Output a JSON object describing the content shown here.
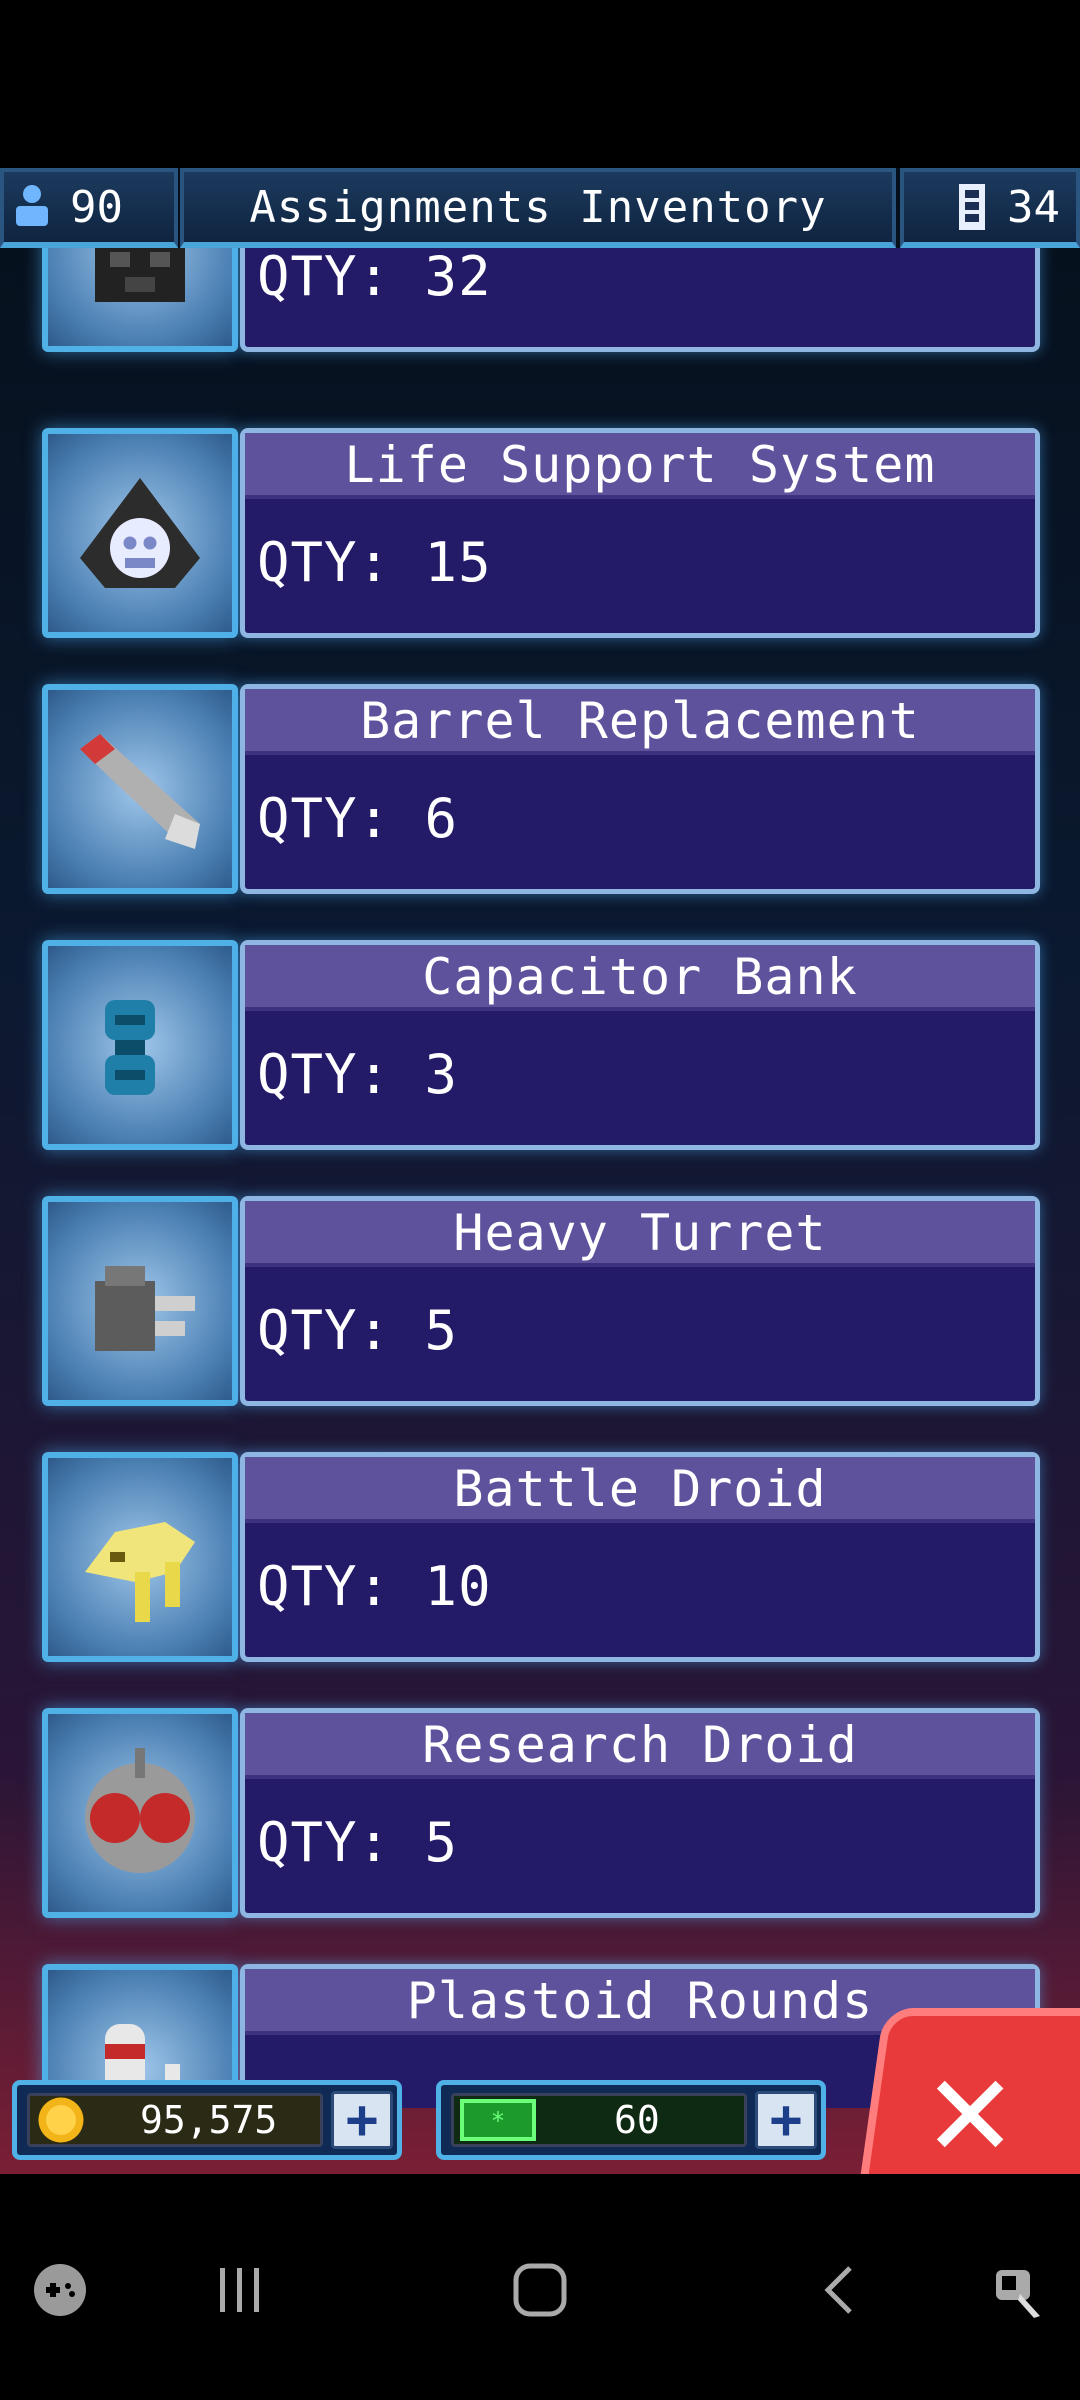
{
  "header": {
    "crew_count": "90",
    "title": "Assignments Inventory",
    "storage_count": "34"
  },
  "items": [
    {
      "name": "",
      "qty": "QTY: 32",
      "icon": "armor-helmet-icon"
    },
    {
      "name": "Life Support System",
      "qty": "QTY: 15",
      "icon": "life-support-icon"
    },
    {
      "name": "Barrel Replacement",
      "qty": "QTY: 6",
      "icon": "barrel-icon"
    },
    {
      "name": "Capacitor Bank",
      "qty": "QTY: 3",
      "icon": "capacitor-icon"
    },
    {
      "name": "Heavy Turret",
      "qty": "QTY: 5",
      "icon": "turret-icon"
    },
    {
      "name": "Battle Droid",
      "qty": "QTY: 10",
      "icon": "battle-droid-icon"
    },
    {
      "name": "Research Droid",
      "qty": "QTY: 5",
      "icon": "research-droid-icon"
    },
    {
      "name": "Plastoid Rounds",
      "qty": "",
      "icon": "plastoid-rounds-icon"
    }
  ],
  "resources": {
    "credits": "95,575",
    "energy": "60"
  },
  "colors": {
    "panel": "#231a68",
    "panel_title": "#5f529d",
    "frame": "#4fb1e6",
    "close": "#e83a3a"
  }
}
